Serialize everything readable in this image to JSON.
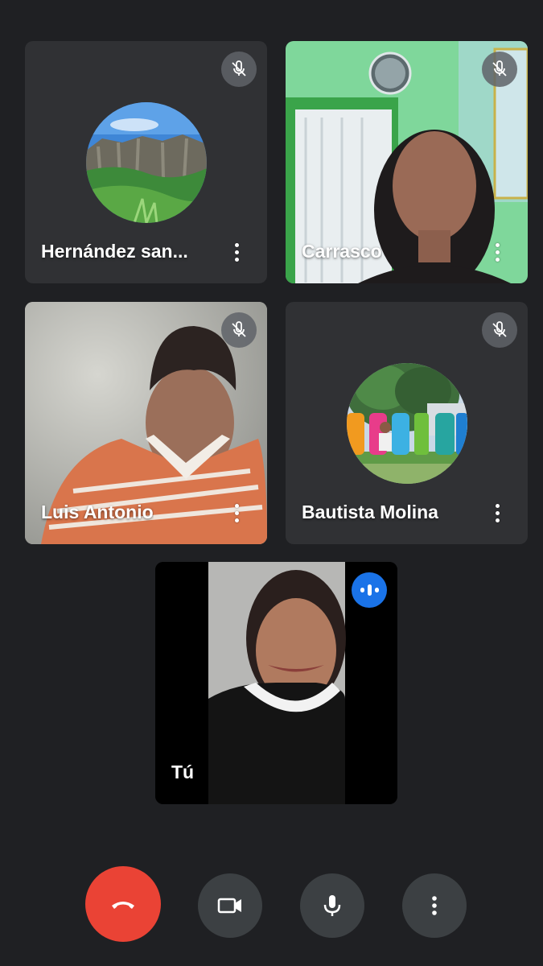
{
  "participants": [
    {
      "name": "Hernández san...",
      "muted": true,
      "media": "avatar"
    },
    {
      "name": "Carrasco",
      "muted": true,
      "media": "video"
    },
    {
      "name": "Luis Antonio",
      "muted": true,
      "media": "video"
    },
    {
      "name": "Bautista Molina",
      "muted": true,
      "media": "avatar"
    },
    {
      "name": "Tú",
      "speaking": true,
      "media": "video"
    }
  ],
  "controls": {
    "end_call": "phone-hangup-icon",
    "camera": "video-camera-icon",
    "microphone": "microphone-icon",
    "more": "more-vert-icon"
  },
  "colors": {
    "background": "#1f2023",
    "tile": "#303134",
    "end_call": "#ea4335",
    "control": "#3c4043",
    "speaking_badge": "#1a73e8"
  }
}
